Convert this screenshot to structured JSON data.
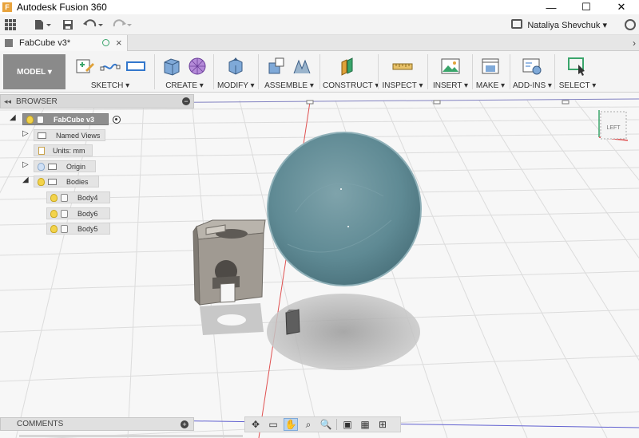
{
  "window": {
    "title": "Autodesk Fusion 360",
    "logo_letter": "F",
    "minimize": "—",
    "maximize": "☐",
    "close": "✕"
  },
  "quick_access": {
    "user_name": "Nataliya Shevchuk ▾"
  },
  "document_tab": {
    "name": "FabCube v3*"
  },
  "toolbar": {
    "workspace": "MODEL ▾",
    "groups": {
      "sketch": "SKETCH ▾",
      "create": "CREATE ▾",
      "modify": "MODIFY ▾",
      "assemble": "ASSEMBLE ▾",
      "construct": "CONSTRUCT ▾",
      "inspect": "INSPECT ▾",
      "insert": "INSERT ▾",
      "make": "MAKE ▾",
      "addins": "ADD-INS ▾",
      "select": "SELECT ▾"
    }
  },
  "browser": {
    "title": "BROWSER",
    "root": "FabCube v3",
    "items": [
      {
        "label": "Named Views"
      },
      {
        "label": "Units: mm"
      },
      {
        "label": "Origin"
      },
      {
        "label": "Bodies"
      },
      {
        "label": "Body4"
      },
      {
        "label": "Body6"
      },
      {
        "label": "Body5"
      }
    ]
  },
  "viewcube": {
    "face": "LEFT"
  },
  "comments": {
    "title": "COMMENTS"
  },
  "colors": {
    "accent": "#0696d7",
    "sphere": "#5f8a94",
    "cube": "#9a948c",
    "axis_red": "#e05050",
    "axis_blue": "#6060d0"
  }
}
